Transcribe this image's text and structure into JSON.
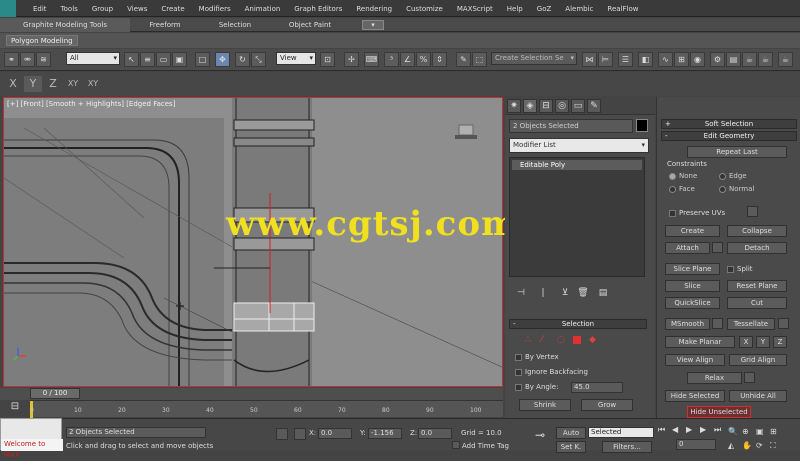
{
  "menubar": {
    "items": [
      "Edit",
      "Tools",
      "Group",
      "Views",
      "Create",
      "Modifiers",
      "Animation",
      "Graph Editors",
      "Rendering",
      "Customize",
      "MAXScript",
      "Help",
      "GoZ",
      "Alembic",
      "RealFlow"
    ]
  },
  "ribbon": {
    "tabs": [
      "Graphite Modeling Tools",
      "Freeform",
      "Selection",
      "Object Paint"
    ],
    "panel_label": "Polygon Modeling"
  },
  "toolbar": {
    "filter_value": "All",
    "refcoord_value": "View",
    "selset_placeholder": "Create Selection Se"
  },
  "axis_constraints": {
    "labels": [
      "X",
      "Y",
      "Z",
      "XY",
      "XY"
    ]
  },
  "viewport": {
    "label": "[+] [Front] [Smooth + Highlights] [Edged Faces]",
    "watermark": "www.cgtsj.com"
  },
  "command_panel": {
    "object_name": "2 Objects Selected",
    "modifier_list": "Modifier List",
    "stack_item": "Editable Poly",
    "selection_rollout": {
      "title": "Selection",
      "by_vertex": "By Vertex",
      "ignore_backfacing": "Ignore Backfacing",
      "by_angle": "By Angle:",
      "angle_value": "45.0",
      "shrink": "Shrink",
      "grow": "Grow"
    }
  },
  "edit_geometry": {
    "soft_selection": "Soft Selection",
    "title": "Edit Geometry",
    "repeat_last": "Repeat Last",
    "constraints_label": "Constraints",
    "constraints": [
      "None",
      "Edge",
      "Face",
      "Normal"
    ],
    "preserve_uvs": "Preserve UVs",
    "create": "Create",
    "collapse": "Collapse",
    "attach": "Attach",
    "detach": "Detach",
    "slice_plane": "Slice Plane",
    "split": "Split",
    "slice": "Slice",
    "reset_plane": "Reset Plane",
    "quickslice": "QuickSlice",
    "cut": "Cut",
    "msmooth": "MSmooth",
    "tessellate": "Tessellate",
    "make_planar": "Make Planar",
    "x": "X",
    "y": "Y",
    "z": "Z",
    "view_align": "View Align",
    "grid_align": "Grid Align",
    "relax": "Relax",
    "hide_selected": "Hide Selected",
    "unhide_all": "Unhide All",
    "hide_unselected": "Hide Unselected"
  },
  "timeline": {
    "slider": "0 / 100",
    "ticks": [
      "0",
      "10",
      "20",
      "30",
      "40",
      "50",
      "60",
      "70",
      "80",
      "90",
      "100"
    ]
  },
  "status": {
    "maxscript": "Welcome to MAX",
    "selection_count": "2 Objects Selected",
    "prompt": "Click and drag to select and move objects",
    "x_label": "X:",
    "x_value": "0.0",
    "y_label": "Y:",
    "y_value": "-1.156",
    "z_label": "Z:",
    "z_value": "0.0",
    "grid": "Grid = 10.0",
    "add_time_tag": "Add Time Tag",
    "auto": "Auto",
    "set_key": "Set K.",
    "selected": "Selected",
    "filters": "Filters...",
    "frame": "0"
  }
}
